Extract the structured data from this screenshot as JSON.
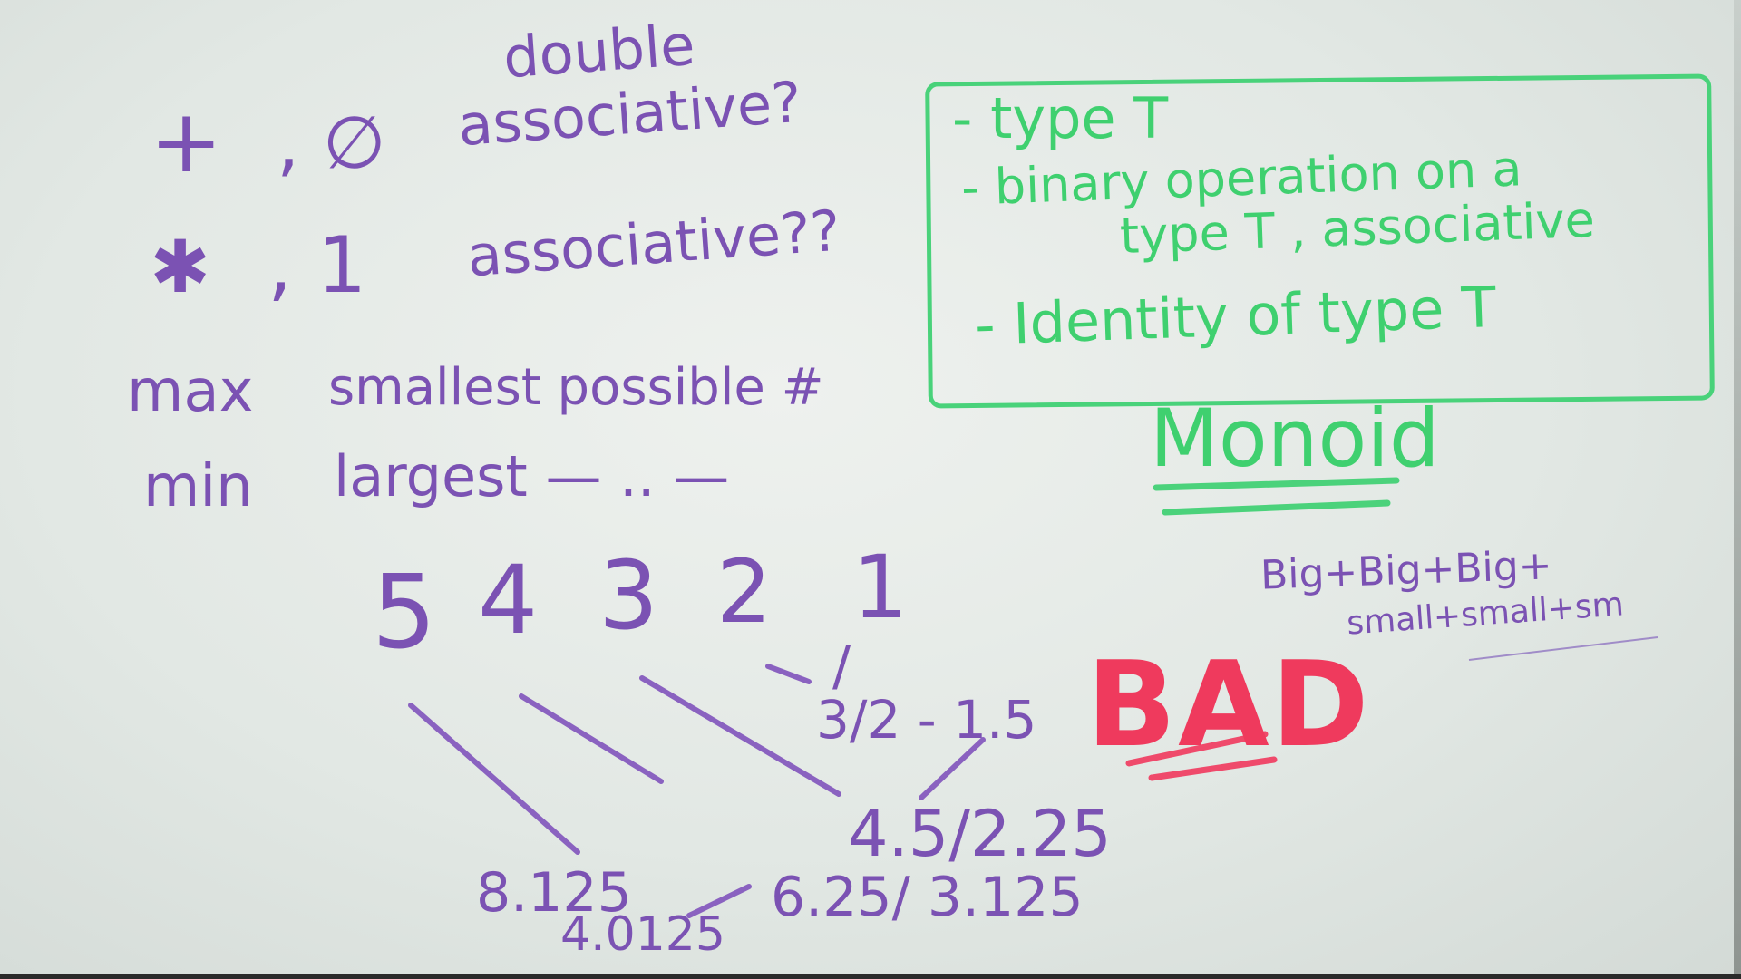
{
  "colors": {
    "purple_marker": "#7b52b3",
    "green_marker": "#3fd06f",
    "red_marker": "#ef3a5d",
    "board": "#e6ebe8"
  },
  "left_notes": {
    "plus": "+",
    "comma_zero": ", ∅",
    "double": "double",
    "associative_q": "associative?",
    "times": "✱",
    "comma_one": ", 1",
    "associative_qq": "associative??",
    "max": "max",
    "smallest": "smallest possible #",
    "min": "min",
    "largest": "largest — .. —"
  },
  "numbers": [
    "5",
    "4",
    "3",
    "2",
    "1"
  ],
  "tree": {
    "slash": "/",
    "three_halves": "3/2 - 1.5",
    "four_five": "4.5/2.25",
    "eight": "8.125",
    "four_zero": "4.0125",
    "six": "6.25/ 3.125"
  },
  "bad": "BAD",
  "monoid_box": {
    "items": [
      "- type T",
      "- binary operation on a",
      "type T , associative",
      "- Identity of type T"
    ],
    "title": "Monoid"
  },
  "big_small": {
    "line1": "Big+Big+Big+",
    "line2": "small+small+sm"
  }
}
